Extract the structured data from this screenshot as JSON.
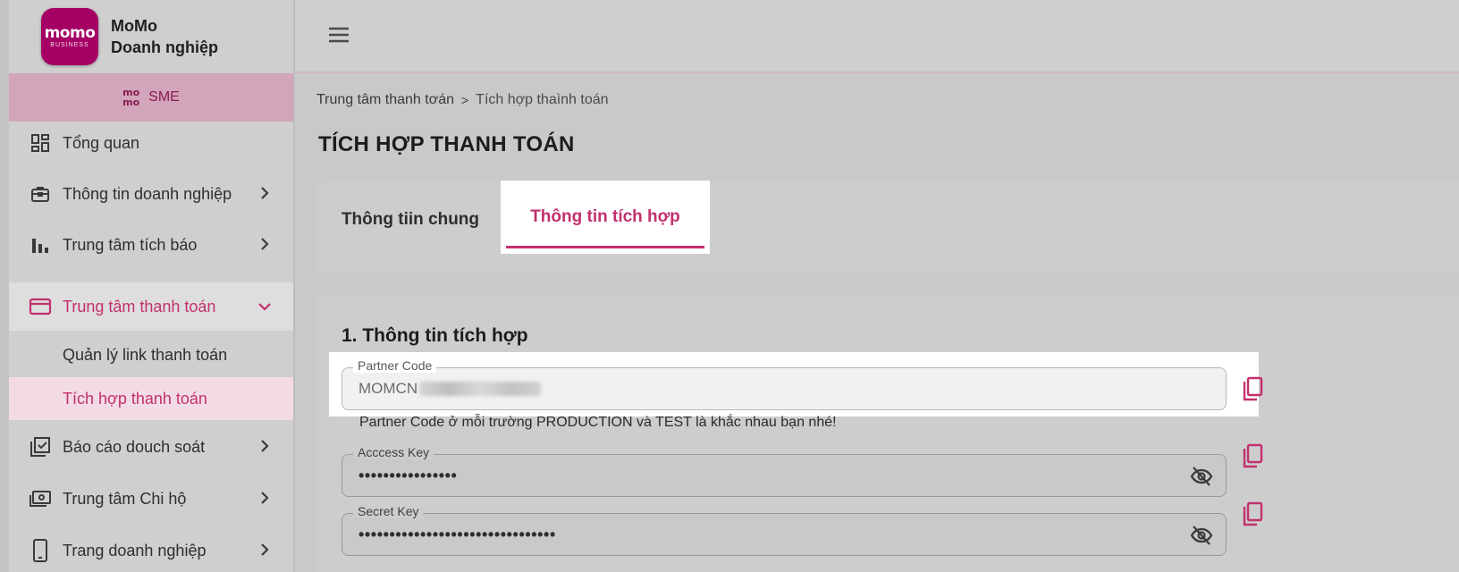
{
  "brand": {
    "logo_text": "momo",
    "logo_sub": "BUSINESS",
    "name_line1": "MoMo",
    "name_line2": "Doanh nghiệp"
  },
  "sme": {
    "mark_top": "mo",
    "mark_bottom": "mo",
    "label": "SME"
  },
  "sidebar": {
    "items": [
      {
        "label": "Tổng quan",
        "icon": "dashboard-icon"
      },
      {
        "label": "Thông tin doanh nghiệp",
        "icon": "briefcase-icon"
      },
      {
        "label": "Trung tâm tích báo",
        "icon": "bar-chart-icon"
      },
      {
        "label": "Trung tâm thanh toán",
        "icon": "credit-card-icon"
      },
      {
        "label": "Báo cáo douch soát",
        "icon": "checklist-icon"
      },
      {
        "label": "Trung tâm Chi hộ",
        "icon": "cash-icon"
      },
      {
        "label": "Trang doanh nghiệp",
        "icon": "phone-icon"
      }
    ],
    "subitems": [
      {
        "label": "Quản lý link thanh toán"
      },
      {
        "label": "Tích hợp thanh toán"
      }
    ]
  },
  "breadcrumb": {
    "parent": "Trung tâm thanh tơán",
    "separator": ">",
    "current": "Tích hợp thaình toán"
  },
  "page_title": "TÍCH HỢP THANH TOÁN",
  "tabs": [
    {
      "label": "Thông tiin chung"
    },
    {
      "label": "Thông tin tích hợp"
    }
  ],
  "section": {
    "title": "1. Thông tin tích hợp",
    "partner_code": {
      "label": "Partner Code",
      "value_prefix": "MOMCN"
    },
    "helper_text": "Partner Code ở mỗi trường PRODUCTION và TEST là khắc nhau bạn nhé!",
    "access_key": {
      "label": "Acccess Key",
      "value": "••••••••••••••••"
    },
    "secret_key": {
      "label": "Secret Key",
      "value": "••••••••••••••••••••••••••••••••"
    }
  },
  "colors": {
    "accent": "#c2306e",
    "brand": "#a50064"
  }
}
